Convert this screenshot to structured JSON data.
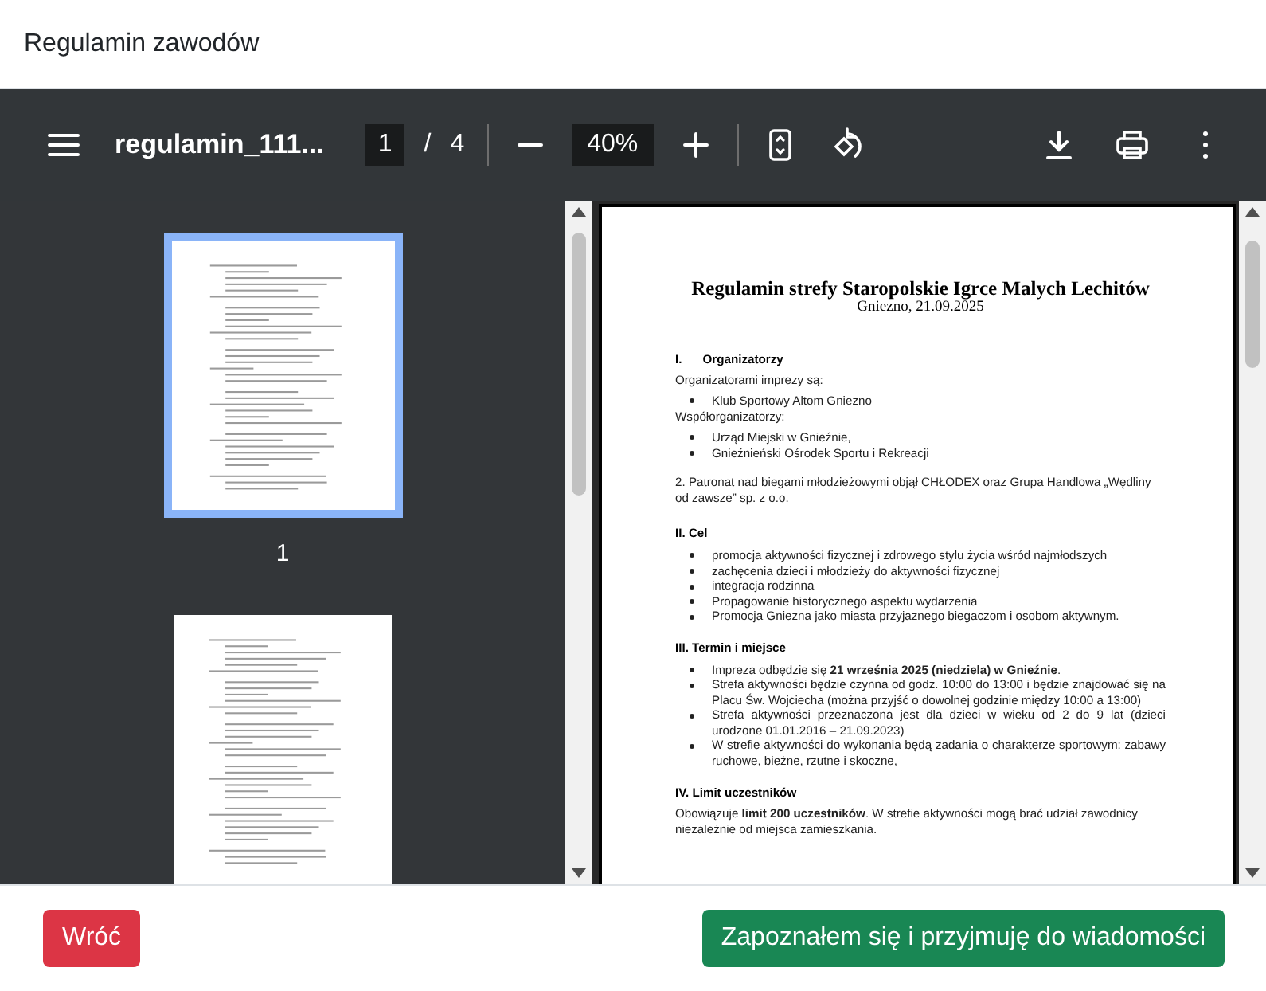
{
  "dialog": {
    "title": "Regulamin zawodów"
  },
  "toolbar": {
    "file_name": "regulamin_111...",
    "page_current": "1",
    "page_separator": "/",
    "page_total": "4",
    "zoom": "40%"
  },
  "thumbnails": [
    {
      "page_label": "1",
      "selected": true
    },
    {
      "selected": false
    }
  ],
  "document": {
    "title": "Regulamin strefy Staropolskie Igrce Malych Lechitów",
    "subtitle": "Gniezno, 21.09.2025",
    "blocks": [
      {
        "kind": "heading",
        "number": "I.",
        "text": "Organizatorzy"
      },
      {
        "kind": "para",
        "text": "Organizatorami imprezy są:"
      },
      {
        "kind": "bullet",
        "text": "Klub Sportowy Altom Gniezno"
      },
      {
        "kind": "para",
        "text": "Współorganizatorzy:"
      },
      {
        "kind": "bullet",
        "text": "Urząd Miejski w Gnieźnie,"
      },
      {
        "kind": "bullet",
        "text": "Gnieźnieński Ośrodek Sportu i Rekreacji"
      },
      {
        "kind": "spacer"
      },
      {
        "kind": "para",
        "text": "2. Patronat nad biegami młodzieżowymi objął CHŁODEX oraz Grupa Handlowa „Wędliny od zawsze” sp. z o.o."
      },
      {
        "kind": "spacer"
      },
      {
        "kind": "heading",
        "text": "II. Cel"
      },
      {
        "kind": "bullet",
        "text": "promocja aktywności fizycznej i zdrowego stylu życia wśród najmłodszych"
      },
      {
        "kind": "bullet",
        "text": "zachęcenia dzieci i młodzieży do aktywności fizycznej"
      },
      {
        "kind": "bullet",
        "text": "integracja rodzinna"
      },
      {
        "kind": "bullet",
        "text": "Propagowanie historycznego aspektu wydarzenia"
      },
      {
        "kind": "bullet",
        "text": "Promocja Gniezna jako miasta przyjaznego biegaczom i osobom aktywnym."
      },
      {
        "kind": "spacer"
      },
      {
        "kind": "heading",
        "text": "III. Termin i miejsce"
      },
      {
        "kind": "bullet",
        "text": "Impreza odbędzie się **21 września 2025 (niedziela) w Gnieźnie**."
      },
      {
        "kind": "bullet",
        "text": "Strefa aktywności  będzie czynna od godz. 10:00 do 13:00 i będzie znajdować się na Placu Św. Wojciecha (można przyjść o dowolnej godzinie między 10:00 a 13:00)"
      },
      {
        "kind": "bullet",
        "text": "Strefa aktywności przeznaczona jest dla dzieci w wieku od 2 do 9 lat (dzieci urodzone 01.01.2016 – 21.09.2023)"
      },
      {
        "kind": "bullet",
        "text": "W strefie aktywności do wykonania będą zadania o charakterze sportowym: zabawy ruchowe, bieżne, rzutne i skoczne,"
      },
      {
        "kind": "spacer"
      },
      {
        "kind": "heading",
        "text": "IV. Limit uczestników"
      },
      {
        "kind": "para",
        "text": "Obowiązuje **limit 200 uczestników**. W strefie aktywności mogą brać udział zawodnicy niezależnie od miejsca zamieszkania."
      }
    ]
  },
  "buttons": [
    {
      "label": "Wróć",
      "kind": "danger"
    },
    {
      "label": "Zapoznałem się i przyjmuję do wiadomości",
      "kind": "success"
    }
  ]
}
